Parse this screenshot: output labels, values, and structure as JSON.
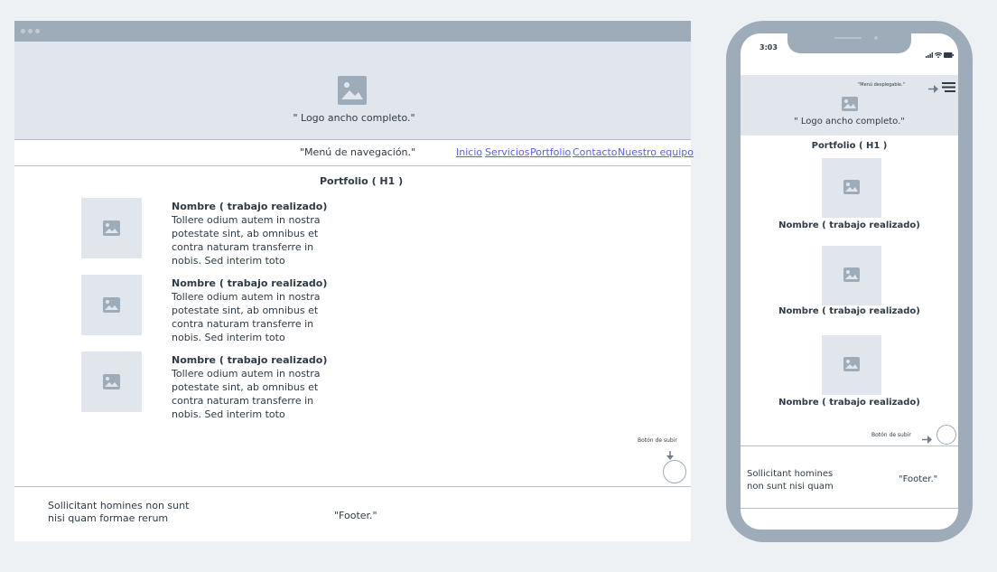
{
  "desktop": {
    "logo_text": "\" Logo ancho completo.\"",
    "menu_label": "\"Menú de navegación.\"",
    "nav_links": [
      "Inicio",
      "Servicios",
      "Portfolio",
      "Contacto",
      "Nuestro equipo"
    ],
    "h1": "Portfolio ( H1 )",
    "items": [
      {
        "title": "Nombre ( trabajo realizado)",
        "lines": [
          "Tollere odium autem in nostra",
          "potestate sint, ab omnibus et",
          "contra naturam transferre in",
          "nobis. Sed interim toto"
        ]
      },
      {
        "title": "Nombre ( trabajo realizado)",
        "lines": [
          "Tollere odium autem in nostra",
          "potestate sint, ab omnibus et",
          "contra naturam transferre in",
          "nobis. Sed interim toto"
        ]
      },
      {
        "title": "Nombre ( trabajo realizado)",
        "lines": [
          "Tollere odium autem in nostra",
          "potestate sint, ab omnibus et",
          "contra naturam transferre in",
          "nobis. Sed interim toto"
        ]
      }
    ],
    "up_button_label": "Botón de subir",
    "footer_text_lines": [
      "Sollicitant homines non sunt",
      "nisi quam formae rerum"
    ],
    "footer_label": "\"Footer.\""
  },
  "mobile": {
    "time": "3:03",
    "dropdown_label": "\"Menú desplegable.\"",
    "logo_text": "\" Logo ancho completo.\"",
    "h1": "Portfolio ( H1 )",
    "items": [
      {
        "title": "Nombre ( trabajo realizado)"
      },
      {
        "title": "Nombre ( trabajo realizado)"
      },
      {
        "title": "Nombre ( trabajo realizado)"
      }
    ],
    "up_button_label": "Botón de subir",
    "footer_text_lines": [
      "Sollicitant homines",
      "non sunt nisi quam"
    ],
    "footer_label": "\"Footer.\""
  },
  "colors": {
    "wire_gray": "#9eabb8",
    "light_fill": "#e1e6ec",
    "link_blue": "#5a62e0",
    "background": "#eef1f4"
  },
  "icons": [
    "image-placeholder-icon",
    "arrow-right-icon",
    "hamburger-menu-icon",
    "arrow-down-icon",
    "signal-icon",
    "wifi-icon",
    "battery-icon"
  ]
}
